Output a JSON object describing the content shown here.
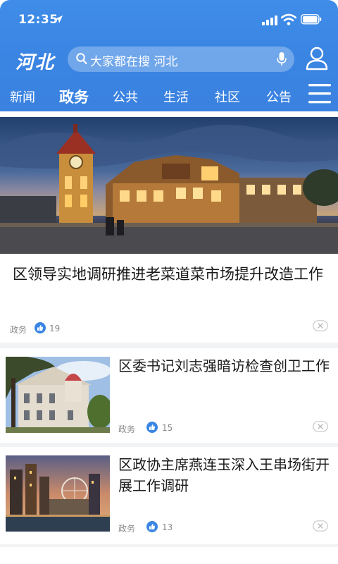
{
  "status": {
    "time": "12:35"
  },
  "header": {
    "logo": "河北",
    "search_placeholder": "大家都在搜 河北"
  },
  "tabs": [
    {
      "label": "新闻",
      "active": false
    },
    {
      "label": "政务",
      "active": true
    },
    {
      "label": "公共",
      "active": false
    },
    {
      "label": "生活",
      "active": false
    },
    {
      "label": "社区",
      "active": false
    },
    {
      "label": "公告",
      "active": false
    }
  ],
  "feed": {
    "lead": {
      "title": "区领导实地调研推进老菜道菜市场提升改造工作",
      "category": "政务",
      "likes": "19"
    },
    "items": [
      {
        "title": "区委书记刘志强暗访检查创卫工作",
        "category": "政务",
        "likes": "15"
      },
      {
        "title": "区政协主席燕连玉深入王串场街开展工作调研",
        "category": "政务",
        "likes": "13"
      }
    ]
  },
  "colors": {
    "header_blue": "#3b86e4",
    "like_blue": "#3b86e4"
  }
}
